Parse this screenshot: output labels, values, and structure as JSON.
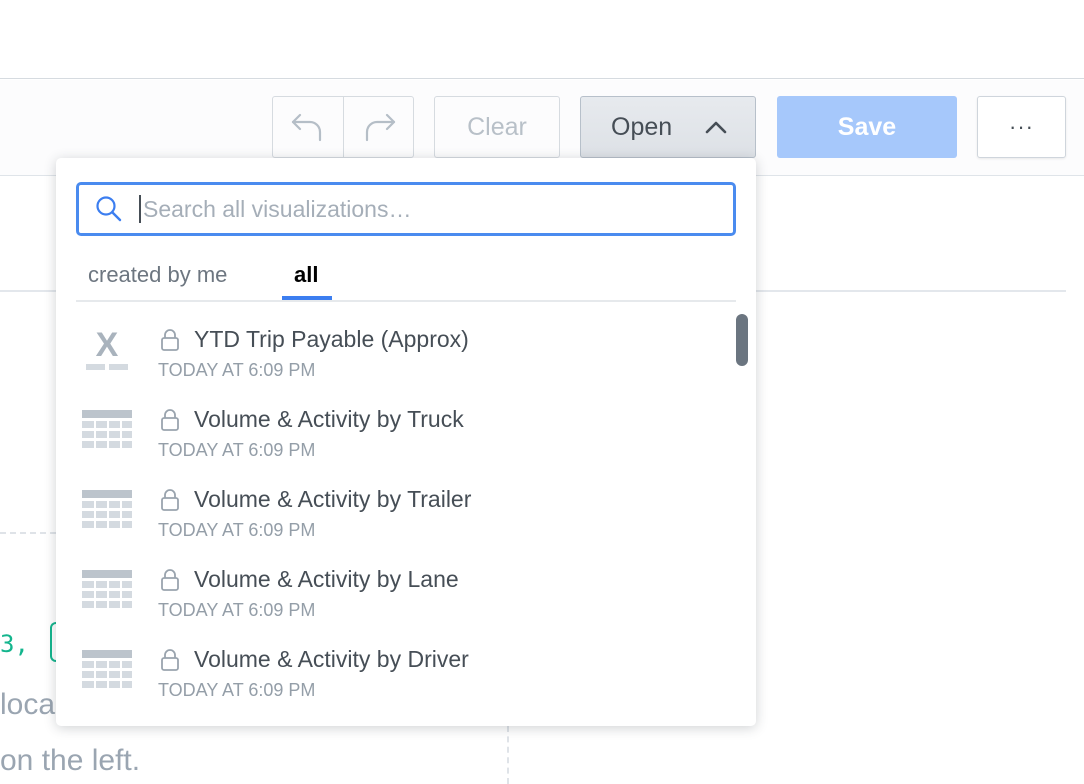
{
  "toolbar": {
    "undo_icon": "undo-arrow",
    "redo_icon": "redo-arrow",
    "clear_label": "Clear",
    "open_label": "Open",
    "save_label": "Save",
    "more_label": "···"
  },
  "background": {
    "code_snippet": "3,",
    "text_line1": "loca",
    "text_line2": "on the left."
  },
  "dropdown": {
    "search_placeholder": "Search all visualizations…",
    "tabs": [
      {
        "label": "created by me",
        "active": false
      },
      {
        "label": "all",
        "active": true
      }
    ],
    "items": [
      {
        "title": "YTD Trip Payable (Approx)",
        "date": "TODAY AT 6:09 PM",
        "icon": "headline-x-icon",
        "locked": true
      },
      {
        "title": "Volume & Activity by Truck",
        "date": "TODAY AT 6:09 PM",
        "icon": "table-icon",
        "locked": true
      },
      {
        "title": "Volume & Activity by Trailer",
        "date": "TODAY AT 6:09 PM",
        "icon": "table-icon",
        "locked": true
      },
      {
        "title": "Volume & Activity by Lane",
        "date": "TODAY AT 6:09 PM",
        "icon": "table-icon",
        "locked": true
      },
      {
        "title": "Volume & Activity by Driver",
        "date": "TODAY AT 6:09 PM",
        "icon": "table-icon",
        "locked": true
      }
    ]
  },
  "colors": {
    "accent": "#3c7ef0",
    "save_button": "#a6c8fb",
    "code_green": "#13b58d"
  }
}
